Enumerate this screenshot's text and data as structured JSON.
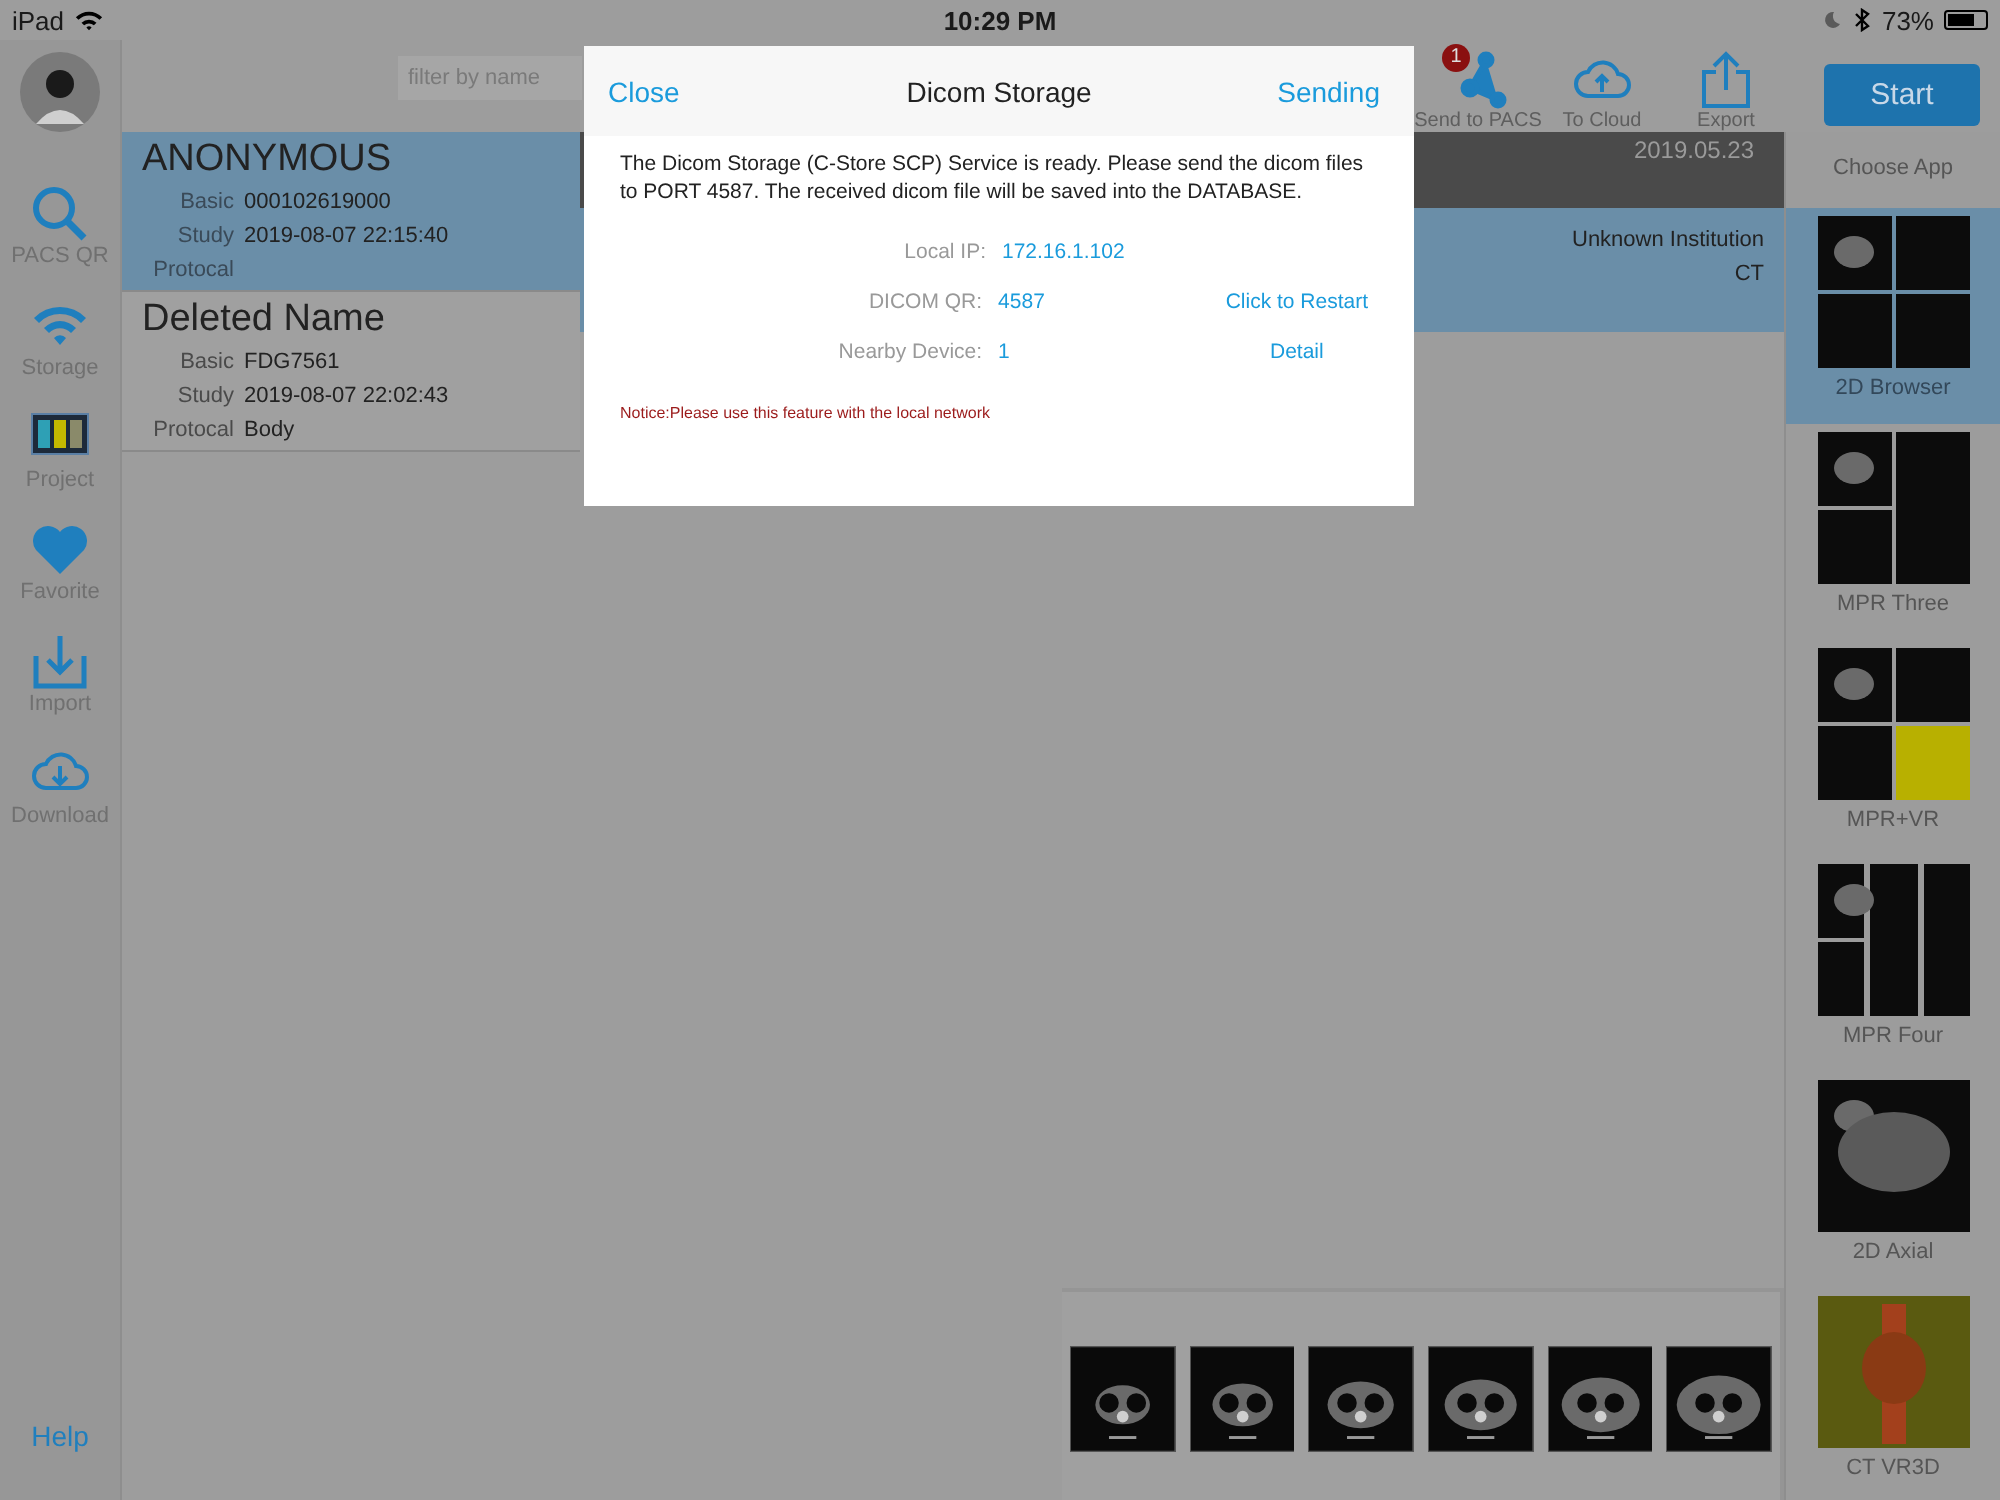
{
  "status_bar": {
    "device": "iPad",
    "time": "10:29 PM",
    "battery": "73%"
  },
  "sidebar": {
    "items": [
      {
        "label": "PACS QR",
        "kind": "search"
      },
      {
        "label": "Storage",
        "kind": "wifi"
      },
      {
        "label": "Project",
        "kind": "project"
      },
      {
        "label": "Favorite",
        "kind": "heart"
      },
      {
        "label": "Import",
        "kind": "import"
      },
      {
        "label": "Download",
        "kind": "download"
      }
    ],
    "help": "Help"
  },
  "filter": {
    "placeholder": "filter by name"
  },
  "toolbar": {
    "actions": [
      {
        "label": "Send to PACS",
        "kind": "share",
        "badge": "1"
      },
      {
        "label": "To Cloud",
        "kind": "cloud-upload"
      },
      {
        "label": "Export",
        "kind": "export"
      }
    ],
    "start_button": "Start"
  },
  "patients": [
    {
      "name": "ANONYMOUS",
      "selected": true,
      "fields": [
        {
          "label": "Basic",
          "value": "000102619000"
        },
        {
          "label": "Study",
          "value": "2019-08-07 22:15:40"
        },
        {
          "label": "Protocal"
        }
      ]
    },
    {
      "name": "Deleted Name",
      "selected": false,
      "fields": [
        {
          "label": "Basic",
          "value": "FDG7561"
        },
        {
          "label": "Study",
          "value": "2019-08-07 22:02:43"
        },
        {
          "label": "Protocal",
          "value": "Body"
        }
      ]
    }
  ],
  "series": {
    "date": "2019.05.23",
    "institution": "Unknown Institution",
    "modality": "CT"
  },
  "apps": {
    "title": "Choose App",
    "items": [
      {
        "label": "2D Browser",
        "selected": true
      },
      {
        "label": "MPR Three",
        "selected": false
      },
      {
        "label": "MPR+VR",
        "selected": false
      },
      {
        "label": "MPR Four",
        "selected": false
      },
      {
        "label": "2D Axial",
        "selected": false
      },
      {
        "label": "CT VR3D",
        "selected": false
      }
    ]
  },
  "dialog": {
    "close": "Close",
    "title": "Dicom Storage",
    "action": "Sending",
    "message": "The Dicom Storage (C-Store SCP) Service is ready. Please send the dicom files to PORT 4587. The received dicom file will be saved into the DATABASE.",
    "rows": [
      {
        "label": "Local IP:",
        "value": "172.16.1.102"
      },
      {
        "label": "DICOM QR:",
        "value": "4587",
        "link": "Click to Restart"
      },
      {
        "label": "Nearby Device:",
        "value": "1",
        "link": "Detail"
      }
    ],
    "notice": "Notice:Please use this feature with the local network"
  }
}
